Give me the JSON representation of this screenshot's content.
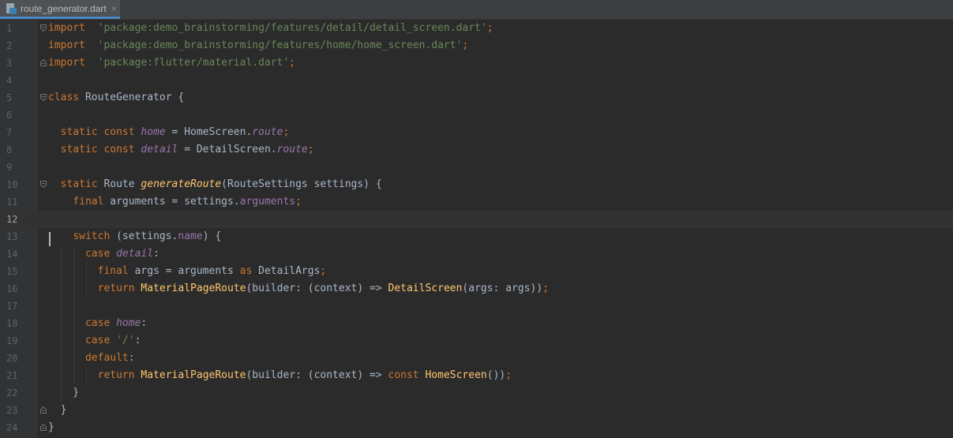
{
  "tab": {
    "filename": "route_generator.dart",
    "close_glyph": "×",
    "icon": "dart-file-icon"
  },
  "editor": {
    "current_line": 12,
    "lines": [
      {
        "n": "1",
        "tokens": [
          [
            "kw",
            "import"
          ],
          [
            "",
            "  "
          ],
          [
            "str",
            "'package:demo_brainstorming/features/detail/detail_screen.dart'"
          ],
          [
            "kw",
            ";"
          ]
        ]
      },
      {
        "n": "2",
        "tokens": [
          [
            "kw",
            "import"
          ],
          [
            "",
            "  "
          ],
          [
            "str",
            "'package:demo_brainstorming/features/home/home_screen.dart'"
          ],
          [
            "kw",
            ";"
          ]
        ]
      },
      {
        "n": "3",
        "tokens": [
          [
            "kw",
            "import"
          ],
          [
            "",
            "  "
          ],
          [
            "str",
            "'package:flutter/material.dart'"
          ],
          [
            "kw",
            ";"
          ]
        ]
      },
      {
        "n": "4",
        "tokens": []
      },
      {
        "n": "5",
        "tokens": [
          [
            "kw",
            "class"
          ],
          [
            "",
            " RouteGenerator {"
          ]
        ]
      },
      {
        "n": "6",
        "tokens": []
      },
      {
        "n": "7",
        "tokens": [
          [
            "",
            "  "
          ],
          [
            "kw",
            "static const"
          ],
          [
            "",
            " "
          ],
          [
            "field",
            "home"
          ],
          [
            "",
            " = HomeScreen."
          ],
          [
            "field",
            "route"
          ],
          [
            "kw",
            ";"
          ]
        ]
      },
      {
        "n": "8",
        "tokens": [
          [
            "",
            "  "
          ],
          [
            "kw",
            "static const"
          ],
          [
            "",
            " "
          ],
          [
            "field",
            "detail"
          ],
          [
            "",
            " = DetailScreen."
          ],
          [
            "field",
            "route"
          ],
          [
            "kw",
            ";"
          ]
        ]
      },
      {
        "n": "9",
        "tokens": []
      },
      {
        "n": "10",
        "tokens": [
          [
            "",
            "  "
          ],
          [
            "kw",
            "static"
          ],
          [
            "",
            " Route "
          ],
          [
            "fn-it",
            "generateRoute"
          ],
          [
            "",
            "(RouteSettings settings) {"
          ]
        ]
      },
      {
        "n": "11",
        "tokens": [
          [
            "",
            "    "
          ],
          [
            "kw",
            "final"
          ],
          [
            "",
            " arguments = settings."
          ],
          [
            "prop",
            "arguments"
          ],
          [
            "kw",
            ";"
          ]
        ]
      },
      {
        "n": "12",
        "tokens": []
      },
      {
        "n": "13",
        "tokens": [
          [
            "",
            "    "
          ],
          [
            "kw",
            "switch"
          ],
          [
            "",
            " (settings."
          ],
          [
            "prop",
            "name"
          ],
          [
            "",
            ") {"
          ]
        ]
      },
      {
        "n": "14",
        "tokens": [
          [
            "",
            "      "
          ],
          [
            "kw",
            "case"
          ],
          [
            "",
            " "
          ],
          [
            "field",
            "detail"
          ],
          [
            "",
            ":"
          ]
        ]
      },
      {
        "n": "15",
        "tokens": [
          [
            "",
            "        "
          ],
          [
            "kw",
            "final"
          ],
          [
            "",
            " args = arguments "
          ],
          [
            "kw",
            "as"
          ],
          [
            "",
            " DetailArgs"
          ],
          [
            "kw",
            ";"
          ]
        ]
      },
      {
        "n": "16",
        "tokens": [
          [
            "",
            "        "
          ],
          [
            "kw",
            "return"
          ],
          [
            "",
            " "
          ],
          [
            "fn",
            "MaterialPageRoute"
          ],
          [
            "",
            "(builder: (context) => "
          ],
          [
            "fn",
            "DetailScreen"
          ],
          [
            "",
            "(args: args))"
          ],
          [
            "kw",
            ";"
          ]
        ]
      },
      {
        "n": "17",
        "tokens": []
      },
      {
        "n": "18",
        "tokens": [
          [
            "",
            "      "
          ],
          [
            "kw",
            "case"
          ],
          [
            "",
            " "
          ],
          [
            "field",
            "home"
          ],
          [
            "",
            ":"
          ]
        ]
      },
      {
        "n": "19",
        "tokens": [
          [
            "",
            "      "
          ],
          [
            "kw",
            "case"
          ],
          [
            "",
            " "
          ],
          [
            "str",
            "'/'"
          ],
          [
            "",
            ":"
          ]
        ]
      },
      {
        "n": "20",
        "tokens": [
          [
            "",
            "      "
          ],
          [
            "kw",
            "default"
          ],
          [
            "",
            ":"
          ]
        ]
      },
      {
        "n": "21",
        "tokens": [
          [
            "",
            "        "
          ],
          [
            "kw",
            "return"
          ],
          [
            "",
            " "
          ],
          [
            "fn",
            "MaterialPageRoute"
          ],
          [
            "",
            "(builder: (context) => "
          ],
          [
            "kw",
            "const"
          ],
          [
            "",
            " "
          ],
          [
            "fn",
            "HomeScreen"
          ],
          [
            "",
            "())"
          ],
          [
            "kw",
            ";"
          ]
        ]
      },
      {
        "n": "22",
        "tokens": [
          [
            "",
            "    }"
          ]
        ]
      },
      {
        "n": "23",
        "tokens": [
          [
            "",
            "  }"
          ]
        ]
      },
      {
        "n": "24",
        "tokens": [
          [
            "",
            "}"
          ]
        ]
      }
    ]
  }
}
